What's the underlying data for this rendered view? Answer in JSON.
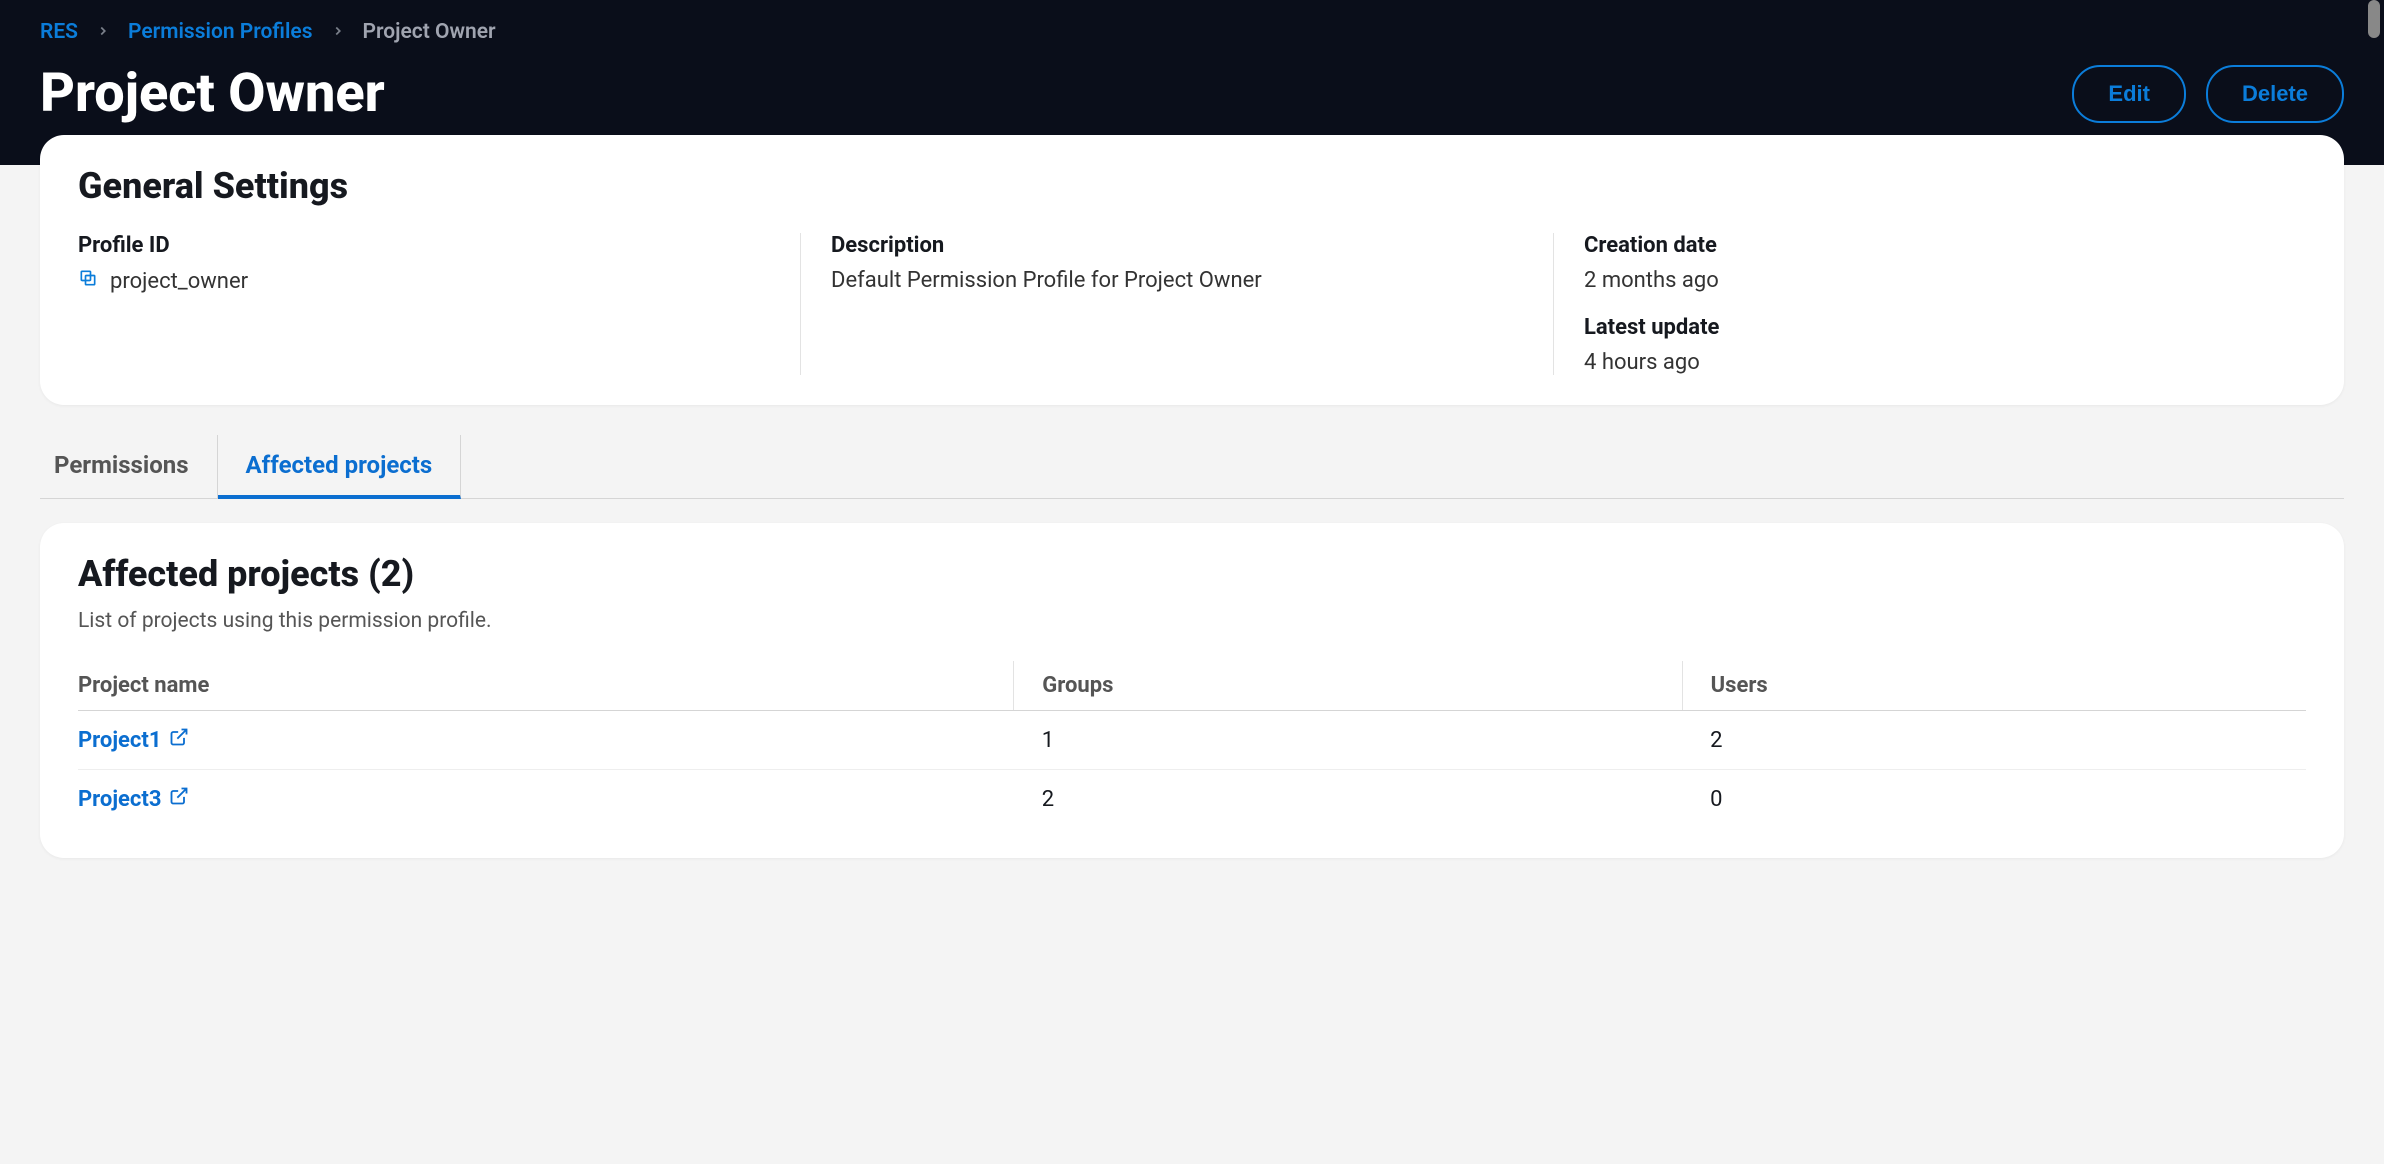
{
  "breadcrumb": {
    "root": "RES",
    "parent": "Permission Profiles",
    "current": "Project Owner"
  },
  "page_title": "Project Owner",
  "actions": {
    "edit": "Edit",
    "delete": "Delete"
  },
  "general": {
    "heading": "General Settings",
    "profile_id_label": "Profile ID",
    "profile_id_value": "project_owner",
    "description_label": "Description",
    "description_value": "Default Permission Profile for Project Owner",
    "creation_label": "Creation date",
    "creation_value": "2 months ago",
    "update_label": "Latest update",
    "update_value": "4 hours ago"
  },
  "tabs": {
    "permissions": "Permissions",
    "affected": "Affected projects"
  },
  "affected": {
    "heading": "Affected projects (2)",
    "subtitle": "List of projects using this permission profile.",
    "columns": {
      "name": "Project name",
      "groups": "Groups",
      "users": "Users"
    },
    "rows": [
      {
        "name": "Project1",
        "groups": "1",
        "users": "2"
      },
      {
        "name": "Project3",
        "groups": "2",
        "users": "0"
      }
    ]
  }
}
